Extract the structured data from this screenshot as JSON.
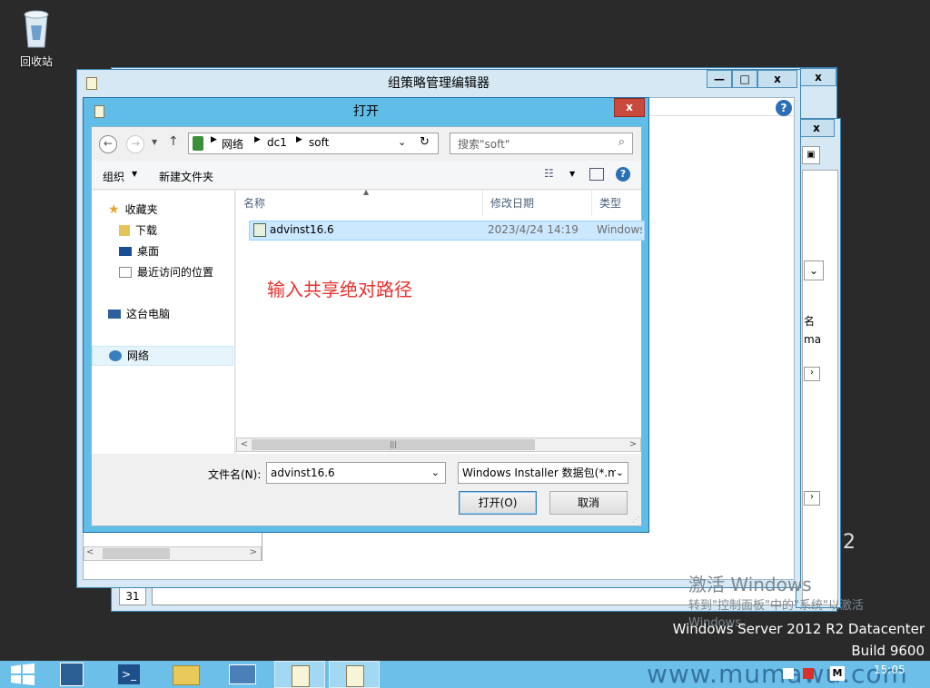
{
  "desktop": {
    "recycle_bin_label": "回收站"
  },
  "gpm_window": {
    "title": "组策略管理编辑器",
    "status_number": "31"
  },
  "open_dialog": {
    "title": "打开",
    "address": {
      "root": "网络",
      "segments": [
        "dc1",
        "soft"
      ]
    },
    "search": {
      "placeholder": "搜索\"soft\""
    },
    "toolbar": {
      "organize": "组织",
      "new_folder": "新建文件夹"
    },
    "nav": {
      "favorites": "收藏夹",
      "downloads": "下载",
      "desktop": "桌面",
      "recent": "最近访问的位置",
      "this_pc": "这台电脑",
      "network": "网络"
    },
    "columns": {
      "name": "名称",
      "modified": "修改日期",
      "type": "类型"
    },
    "files": [
      {
        "name": "advinst16.6",
        "modified": "2023/4/24 14:19",
        "type": "Windows"
      }
    ],
    "annotation": "输入共享绝对路径",
    "filename_label": "文件名(N):",
    "filename_value": "advinst16.6",
    "filter_value": "Windows Installer 数据包(*.m",
    "open_button": "打开(O)",
    "cancel_button": "取消"
  },
  "partial_right": {
    "char1": "名",
    "char2": "ma",
    "number": "2"
  },
  "activation": {
    "title": "激活 Windows",
    "line1": "转到\"控制面板\"中的\"系统\"以激活",
    "line2": "Windows。"
  },
  "os": {
    "edition": "Windows Server 2012 R2 Datacenter",
    "build": "Build 9600"
  },
  "taskbar": {
    "clock": "15:05",
    "watermark": "www.mumawu.com"
  },
  "colors": {
    "annotation": "#e6322e",
    "taskbar": "#6cbfe9",
    "title_bar": "#5fbde8"
  }
}
